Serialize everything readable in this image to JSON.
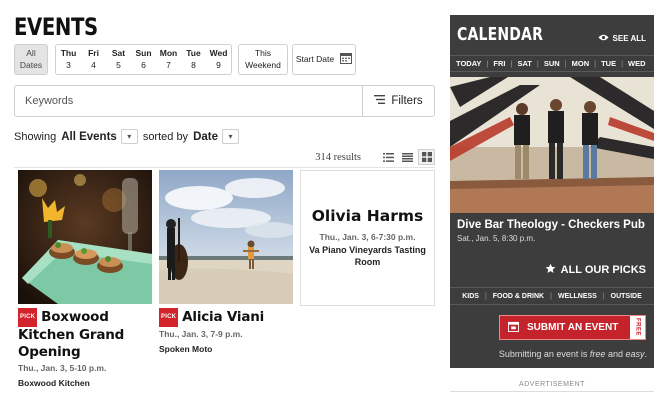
{
  "page": {
    "title": "EVENTS"
  },
  "date_filters": {
    "all": {
      "line1": "All",
      "line2": "Dates"
    },
    "days": [
      {
        "name": "Thu",
        "num": "3"
      },
      {
        "name": "Fri",
        "num": "4"
      },
      {
        "name": "Sat",
        "num": "5"
      },
      {
        "name": "Sun",
        "num": "6"
      },
      {
        "name": "Mon",
        "num": "7"
      },
      {
        "name": "Tue",
        "num": "8"
      },
      {
        "name": "Wed",
        "num": "9"
      }
    ],
    "weekend": {
      "line1": "This",
      "line2": "Weekend"
    },
    "start_date": "Start Date"
  },
  "search": {
    "placeholder": "Keywords",
    "filters_label": "Filters"
  },
  "sort": {
    "showing_label": "Showing",
    "showing_value": "All Events",
    "sorted_label": "sorted by",
    "sorted_value": "Date"
  },
  "results": {
    "count": "314 results"
  },
  "events": [
    {
      "badge": "PICK",
      "title": "Boxwood Kitchen Grand Opening",
      "date": "Thu., Jan. 3, 5-10 p.m.",
      "venue": "Boxwood Kitchen"
    },
    {
      "badge": "PICK",
      "title": "Alicia Viani",
      "date": "Thu., Jan. 3, 7-9 p.m.",
      "venue": "Spoken Moto"
    },
    {
      "title": "Olivia Harms",
      "date": "Thu., Jan. 3, 6-7:30 p.m.",
      "venue": "Va Piano Vineyards Tasting Room"
    }
  ],
  "calendar": {
    "title": "CALENDAR",
    "see_all": "SEE ALL",
    "tabs": [
      "TODAY",
      "FRI",
      "SAT",
      "SUN",
      "MON",
      "TUE",
      "WED"
    ],
    "featured": {
      "title": "Dive Bar Theology - Checkers Pub",
      "date": "Sat., Jan. 5, 8:30 p.m."
    },
    "all_picks": "ALL OUR PICKS",
    "categories": [
      "KIDS",
      "FOOD & DRINK",
      "WELLNESS",
      "OUTSIDE"
    ],
    "submit": {
      "label": "SUBMIT AN EVENT",
      "free": "FREE"
    },
    "note": {
      "prefix": "Submitting an event is ",
      "free": "free",
      "middle": " and ",
      "easy": "easy",
      "suffix": "."
    }
  },
  "advertisement": "ADVERTISEMENT",
  "colors": {
    "accent_red": "#c5232b",
    "calendar_bg": "#3d3d3d"
  }
}
